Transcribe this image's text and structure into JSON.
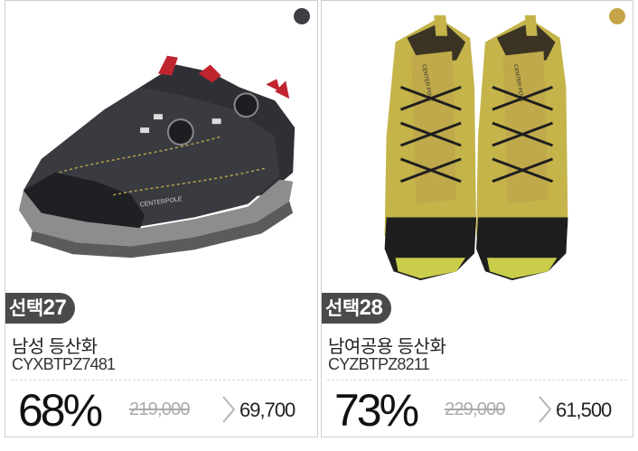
{
  "products": [
    {
      "choice_label": "선택",
      "choice_number": "27",
      "name": "남성 등산화",
      "code": "CYXBTPZ7481",
      "discount": "68%",
      "original_price": "219,000",
      "sale_price": "69,700",
      "swatch_color": "#3e3f44",
      "swatch_name": "charcoal",
      "image_brand_text": "CENTERPOLE"
    },
    {
      "choice_label": "선택",
      "choice_number": "28",
      "name": "남여공용 등산화",
      "code": "CYZBTPZ8211",
      "discount": "73%",
      "original_price": "229,000",
      "sale_price": "61,500",
      "swatch_color": "#c6a548",
      "swatch_name": "mustard",
      "image_brand_text": "CENTER POLE"
    }
  ]
}
